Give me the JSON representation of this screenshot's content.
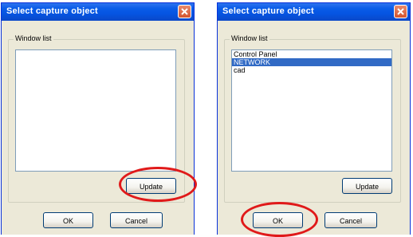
{
  "dialogs": [
    {
      "title": "Select capture object",
      "group_label": "Window list",
      "list_items": [],
      "update_label": "Update",
      "ok_label": "OK",
      "cancel_label": "Cancel"
    },
    {
      "title": "Select capture object",
      "group_label": "Window list",
      "list_items": [
        {
          "label": "Control Panel",
          "selected": false
        },
        {
          "label": "NETWORK",
          "selected": true
        },
        {
          "label": "cad",
          "selected": false
        }
      ],
      "update_label": "Update",
      "ok_label": "OK",
      "cancel_label": "Cancel"
    }
  ],
  "colors": {
    "titlebar": "#0a5ce8",
    "selection": "#316ac5",
    "annotation_circle": "#e01a1a",
    "dialog_background": "#ece9d8"
  },
  "icons": {
    "close": "close-x-icon"
  }
}
